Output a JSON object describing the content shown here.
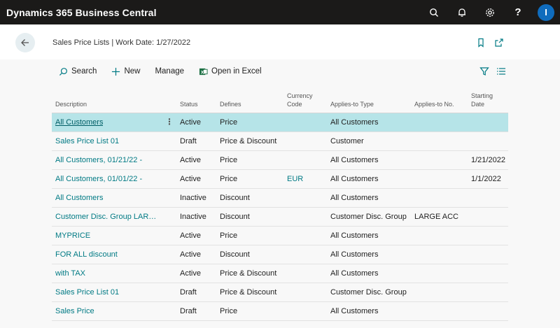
{
  "app": {
    "title": "Dynamics 365 Business Central",
    "help_label": "?",
    "avatar_initial": "I"
  },
  "page": {
    "title": "Sales Price Lists | Work Date: 1/27/2022"
  },
  "actions": {
    "search": "Search",
    "new": "New",
    "manage": "Manage",
    "excel": "Open in Excel"
  },
  "columns": {
    "description": "Description",
    "status": "Status",
    "defines": "Defines",
    "currency_line1": "Currency",
    "currency_line2": "Code",
    "applies_type": "Applies-to Type",
    "applies_no": "Applies-to No.",
    "starting_line1": "Starting",
    "starting_line2": "Date"
  },
  "rows": [
    {
      "description": "All Customers",
      "status": "Active",
      "defines": "Price",
      "currency": "",
      "applies_type": "All Customers",
      "applies_no": "",
      "starting": ""
    },
    {
      "description": "Sales Price List 01",
      "status": "Draft",
      "defines": "Price & Discount",
      "currency": "",
      "applies_type": "Customer",
      "applies_no": "",
      "starting": ""
    },
    {
      "description": "All Customers, 01/21/22 -",
      "status": "Active",
      "defines": "Price",
      "currency": "",
      "applies_type": "All Customers",
      "applies_no": "",
      "starting": "1/21/2022"
    },
    {
      "description": "All Customers, 01/01/22 -",
      "status": "Active",
      "defines": "Price",
      "currency": "EUR",
      "applies_type": "All Customers",
      "applies_no": "",
      "starting": "1/1/2022"
    },
    {
      "description": "All Customers",
      "status": "Inactive",
      "defines": "Discount",
      "currency": "",
      "applies_type": "All Customers",
      "applies_no": "",
      "starting": ""
    },
    {
      "description": "Customer Disc. Group LARG...",
      "status": "Inactive",
      "defines": "Discount",
      "currency": "",
      "applies_type": "Customer Disc. Group",
      "applies_no": "LARGE ACC",
      "starting": ""
    },
    {
      "description": "MYPRICE",
      "status": "Active",
      "defines": "Price",
      "currency": "",
      "applies_type": "All Customers",
      "applies_no": "",
      "starting": ""
    },
    {
      "description": "FOR ALL discount",
      "status": "Active",
      "defines": "Discount",
      "currency": "",
      "applies_type": "All Customers",
      "applies_no": "",
      "starting": ""
    },
    {
      "description": "with TAX",
      "status": "Active",
      "defines": "Price & Discount",
      "currency": "",
      "applies_type": "All Customers",
      "applies_no": "",
      "starting": ""
    },
    {
      "description": "Sales Price List 01",
      "status": "Draft",
      "defines": "Price & Discount",
      "currency": "",
      "applies_type": "Customer Disc. Group",
      "applies_no": "",
      "starting": ""
    },
    {
      "description": "Sales Price",
      "status": "Draft",
      "defines": "Price",
      "currency": "",
      "applies_type": "All Customers",
      "applies_no": "",
      "starting": ""
    }
  ],
  "selected_row": 0,
  "colors": {
    "accent": "#007a84",
    "topbar": "#1b1a19",
    "selected": "#b6e4e8",
    "avatar": "#0f6cbd"
  }
}
